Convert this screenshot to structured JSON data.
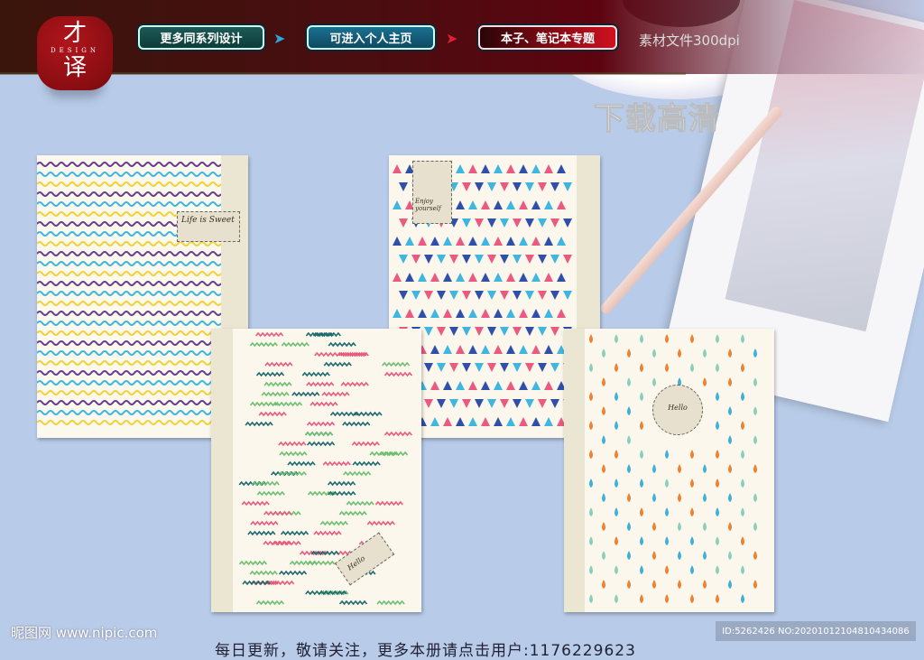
{
  "header": {
    "logo": {
      "char1": "才",
      "sub": "DESIGN",
      "char2": "译"
    },
    "buttons": [
      {
        "label": "更多同系列设计"
      },
      {
        "label": "可进入个人主页"
      },
      {
        "label": "本子、笔记本专题"
      }
    ],
    "resolution": "素材文件300dpi",
    "download": "下载高清"
  },
  "notebooks": [
    {
      "pattern": "waves",
      "label": "Life is Sweet",
      "colors": [
        "#6a3d8e",
        "#3fb6e0",
        "#f2d23a"
      ]
    },
    {
      "pattern": "triangles",
      "label": "Enjoy yourself",
      "colors": [
        "#ea5a80",
        "#2f4fa8",
        "#3fb6e0"
      ]
    },
    {
      "pattern": "zigzag",
      "label": "Hello",
      "colors": [
        "#ea5a80",
        "#1e6a70",
        "#6cc070"
      ]
    },
    {
      "pattern": "drops",
      "label": "Hello",
      "colors": [
        "#3fb0d8",
        "#f08030",
        "#8ad0b8"
      ]
    }
  ],
  "footer": {
    "site": "昵图网 www.nipic.com",
    "id": "ID:5262426 NO:20201012104810434086",
    "notice": "每日更新，敬请关注，更多本册请点击用户:1176229623"
  }
}
